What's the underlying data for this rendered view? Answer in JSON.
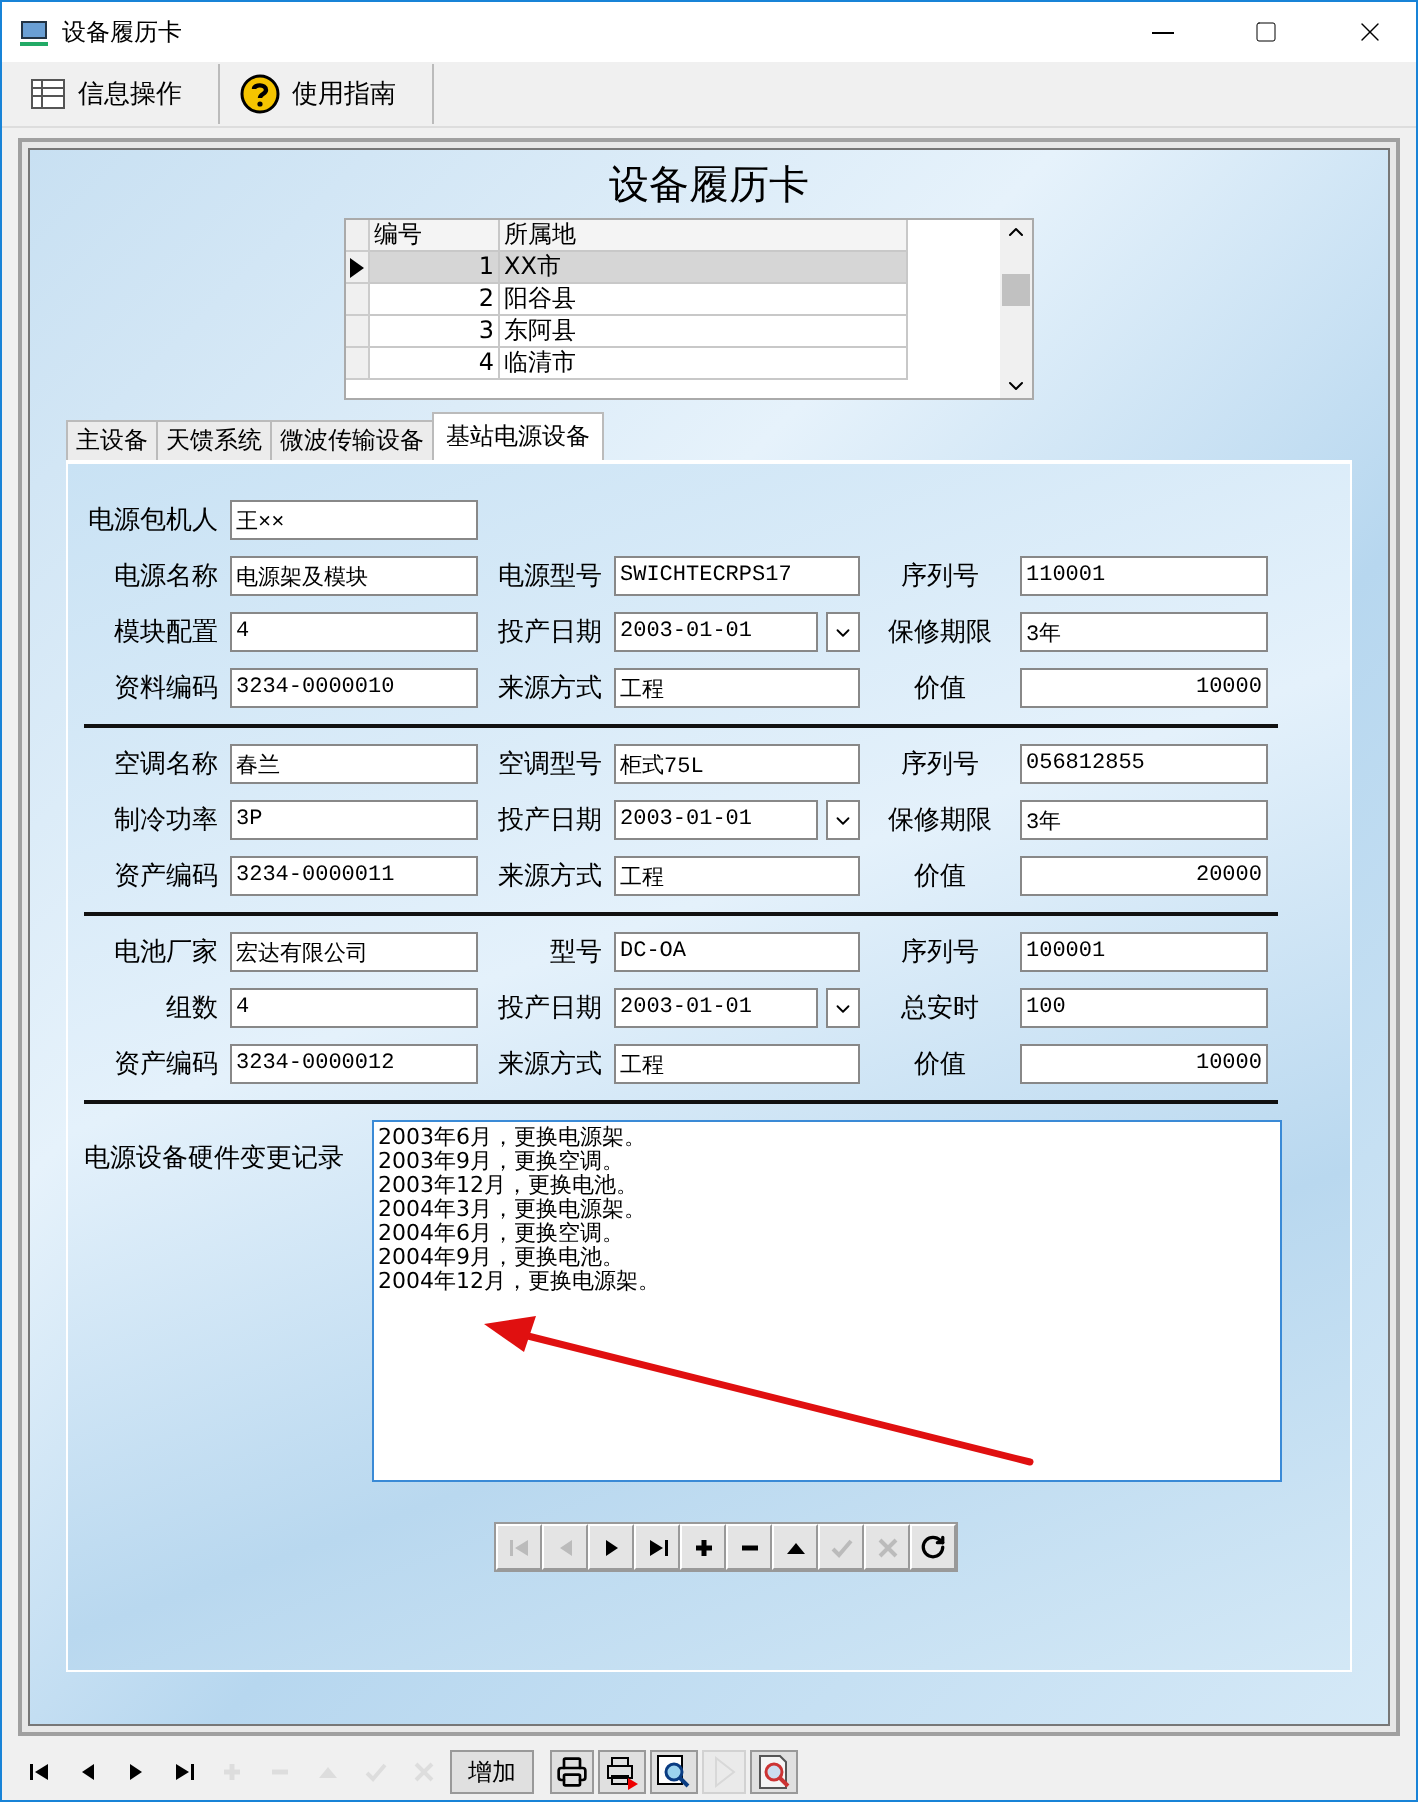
{
  "window": {
    "title": "设备履历卡"
  },
  "toolbar": [
    {
      "kind": "table",
      "label": "信息操作"
    },
    {
      "kind": "help",
      "label": "使用指南"
    }
  ],
  "card_title": "设备履历卡",
  "grid": {
    "columns": [
      "编号",
      "所属地"
    ],
    "rows": [
      {
        "cells": [
          "1",
          "XX市"
        ],
        "selected": true
      },
      {
        "cells": [
          "2",
          "阳谷县"
        ],
        "selected": false
      },
      {
        "cells": [
          "3",
          "东阿县"
        ],
        "selected": false
      },
      {
        "cells": [
          "4",
          "临清市"
        ],
        "selected": false
      }
    ]
  },
  "tabs": [
    {
      "label": "主设备",
      "selected": false
    },
    {
      "label": "天馈系统",
      "selected": false
    },
    {
      "label": "微波传输设备",
      "selected": false
    },
    {
      "label": "基站电源设备",
      "selected": true
    }
  ],
  "sections": [
    {
      "rows": [
        [
          {
            "label": "电源包机人",
            "value": "王××",
            "kind": "text"
          }
        ],
        [
          {
            "label": "电源名称",
            "value": "电源架及模块",
            "kind": "text"
          },
          {
            "label": "电源型号",
            "value": "SWICHTECRPS17",
            "kind": "text"
          },
          {
            "label": "序列号",
            "value": "110001",
            "kind": "text"
          }
        ],
        [
          {
            "label": "模块配置",
            "value": "4",
            "kind": "text"
          },
          {
            "label": "投产日期",
            "value": "2003-01-01",
            "kind": "date"
          },
          {
            "label": "保修期限",
            "value": "3年",
            "kind": "text"
          }
        ],
        [
          {
            "label": "资料编码",
            "value": "3234-0000010",
            "kind": "text"
          },
          {
            "label": "来源方式",
            "value": "工程",
            "kind": "text"
          },
          {
            "label": "价值",
            "value": "10000",
            "kind": "number"
          }
        ]
      ]
    },
    {
      "rows": [
        [
          {
            "label": "空调名称",
            "value": "春兰",
            "kind": "text"
          },
          {
            "label": "空调型号",
            "value": "柜式75L",
            "kind": "text"
          },
          {
            "label": "序列号",
            "value": "056812855",
            "kind": "text"
          }
        ],
        [
          {
            "label": "制冷功率",
            "value": "3P",
            "kind": "text"
          },
          {
            "label": "投产日期",
            "value": "2003-01-01",
            "kind": "date"
          },
          {
            "label": "保修期限",
            "value": "3年",
            "kind": "text"
          }
        ],
        [
          {
            "label": "资产编码",
            "value": "3234-0000011",
            "kind": "text"
          },
          {
            "label": "来源方式",
            "value": "工程",
            "kind": "text"
          },
          {
            "label": "价值",
            "value": "20000",
            "kind": "number"
          }
        ]
      ]
    },
    {
      "rows": [
        [
          {
            "label": "电池厂家",
            "value": "宏达有限公司",
            "kind": "text"
          },
          {
            "label": "型号",
            "value": "DC-OA",
            "kind": "text"
          },
          {
            "label": "序列号",
            "value": "100001",
            "kind": "text"
          }
        ],
        [
          {
            "label": "组数",
            "value": "4",
            "kind": "text"
          },
          {
            "label": "投产日期",
            "value": "2003-01-01",
            "kind": "date"
          },
          {
            "label": "总安时",
            "value": "100",
            "kind": "text"
          }
        ],
        [
          {
            "label": "资产编码",
            "value": "3234-0000012",
            "kind": "text"
          },
          {
            "label": "来源方式",
            "value": "工程",
            "kind": "text"
          },
          {
            "label": "价值",
            "value": "10000",
            "kind": "number"
          }
        ]
      ]
    }
  ],
  "record": {
    "label": "电源设备硬件变更记录",
    "lines": [
      "2003年6月，更换电源架。",
      "2003年9月，更换空调。",
      "2003年12月，更换电池。",
      "2004年3月，更换电源架。",
      "2004年6月，更换空调。",
      "2004年9月，更换电池。",
      "2004年12月，更换电源架。"
    ]
  },
  "navigator": [
    {
      "kind": "first",
      "disabled": true
    },
    {
      "kind": "prev",
      "disabled": true
    },
    {
      "kind": "next",
      "disabled": false
    },
    {
      "kind": "last",
      "disabled": false
    },
    {
      "kind": "add",
      "disabled": false
    },
    {
      "kind": "delete",
      "disabled": false
    },
    {
      "kind": "edit",
      "disabled": false
    },
    {
      "kind": "post",
      "disabled": true
    },
    {
      "kind": "cancel",
      "disabled": true
    },
    {
      "kind": "refresh",
      "disabled": false
    }
  ],
  "bottom_bar": [
    {
      "kind": "first",
      "disabled": false
    },
    {
      "kind": "prev",
      "disabled": false
    },
    {
      "kind": "next",
      "disabled": false
    },
    {
      "kind": "last",
      "disabled": false
    },
    {
      "kind": "add",
      "disabled": true
    },
    {
      "kind": "delete",
      "disabled": true
    },
    {
      "kind": "edit",
      "disabled": true
    },
    {
      "kind": "post",
      "disabled": true
    },
    {
      "kind": "cancel",
      "disabled": true
    },
    {
      "kind": "text",
      "label": "增加",
      "disabled": false
    },
    {
      "kind": "print",
      "disabled": false
    },
    {
      "kind": "print-to",
      "disabled": false
    },
    {
      "kind": "preview",
      "disabled": false
    },
    {
      "kind": "play",
      "disabled": true
    },
    {
      "kind": "zoom",
      "disabled": false
    }
  ]
}
